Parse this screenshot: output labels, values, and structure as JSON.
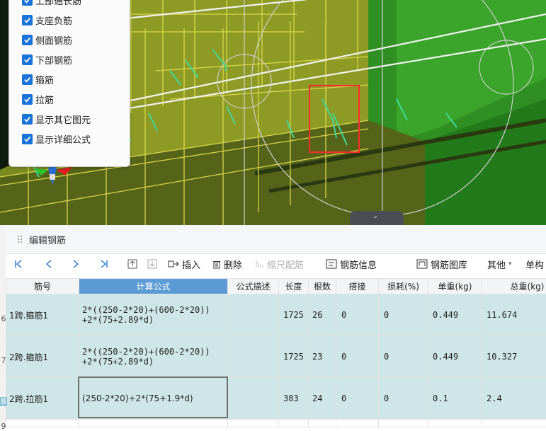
{
  "layers": {
    "items": [
      {
        "label": "上部通长筋",
        "checked": true
      },
      {
        "label": "支座负筋",
        "checked": true
      },
      {
        "label": "侧面钢筋",
        "checked": true
      },
      {
        "label": "下部钢筋",
        "checked": true
      },
      {
        "label": "箍筋",
        "checked": true
      },
      {
        "label": "拉筋",
        "checked": true
      },
      {
        "label": "显示其它图元",
        "checked": true
      },
      {
        "label": "显示详细公式",
        "checked": true
      }
    ]
  },
  "panel": {
    "title": "编辑钢筋"
  },
  "toolbar": {
    "insert": "插入",
    "delete": "删除",
    "scale_rebar": "缩尺配筋",
    "rebar_info": "钢筋信息",
    "rebar_library": "钢筋图库",
    "other": "其他",
    "unit": "单构"
  },
  "table": {
    "headers": [
      "筋号",
      "计算公式",
      "公式描述",
      "长度",
      "根数",
      "搭接",
      "损耗(%)",
      "单重(kg)",
      "总重(kg)"
    ],
    "rows": [
      {
        "num": "6",
        "name": "1跨.箍筋1",
        "formula_l1": "2*((250-2*20)+(600-2*20))",
        "formula_l2": "+2*(75+2.89*d)",
        "desc": "",
        "length": "1725",
        "count": "26",
        "lap": "0",
        "loss": "0",
        "unit_weight": "0.449",
        "total_weight": "11.674"
      },
      {
        "num": "7",
        "name": "2跨.箍筋1",
        "formula_l1": "2*((250-2*20)+(600-2*20))",
        "formula_l2": "+2*(75+2.89*d)",
        "desc": "",
        "length": "1725",
        "count": "23",
        "lap": "0",
        "loss": "0",
        "unit_weight": "0.449",
        "total_weight": "10.327"
      },
      {
        "num": "8",
        "name": "2跨.拉筋1",
        "formula": "(250-2*20)+2*(75+1.9*d)",
        "desc": "",
        "length": "383",
        "count": "24",
        "lap": "0",
        "loss": "0",
        "unit_weight": "0.1",
        "total_weight": "2.4"
      }
    ],
    "partial_row_num": "9"
  }
}
